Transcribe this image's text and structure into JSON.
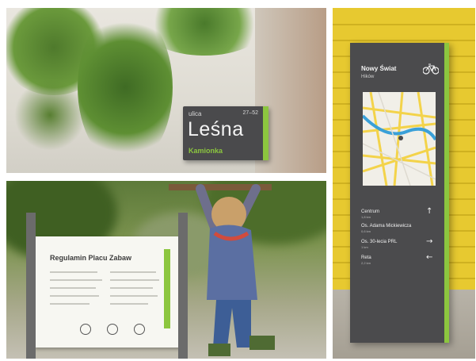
{
  "street_sign": {
    "prefix": "ulica",
    "numbers": "27–52",
    "name": "Leśna",
    "district": "Kamionka"
  },
  "rules_board": {
    "title": "Regulamin Placu Zabaw"
  },
  "totem": {
    "place": "Nowy Świat",
    "subplace": "Hików",
    "icon": "bicycle-icon",
    "destinations": [
      {
        "name": "Centrum",
        "distance": "1,8 km",
        "arrow": "↑"
      },
      {
        "name": "Os. Adama Mickiewicza",
        "distance": "0,6 km",
        "arrow": ""
      },
      {
        "name": "Os. 30-lecia PRL",
        "distance": "1 km",
        "arrow": "→"
      },
      {
        "name": "Reta",
        "distance": "2,2 km",
        "arrow": "←"
      }
    ]
  },
  "colors": {
    "accent_green": "#8cc63f",
    "sign_grey": "#4a4a4c",
    "wall_yellow": "#e7c930"
  }
}
